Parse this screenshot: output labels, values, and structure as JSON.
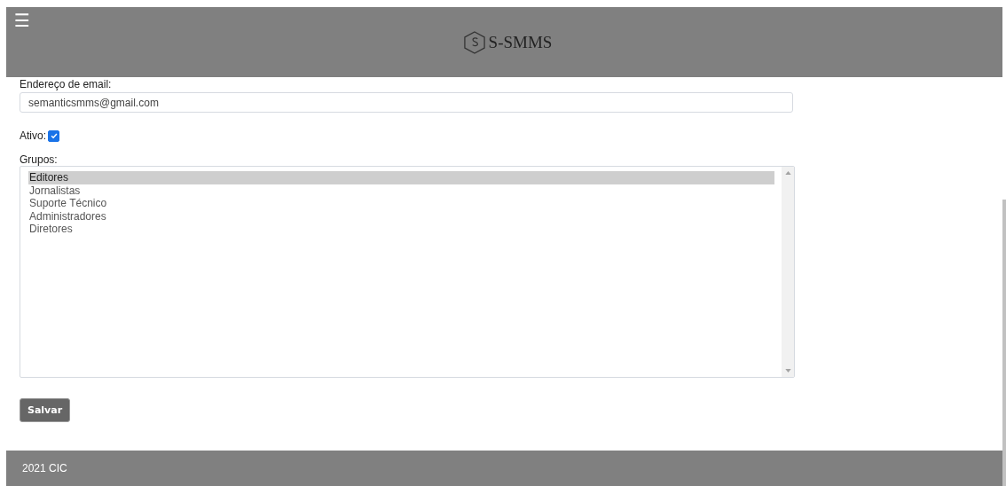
{
  "header": {
    "menu_icon": "☰",
    "brand": "S-SMMS"
  },
  "form": {
    "email": {
      "label": "Endereço de email:",
      "value": "semanticsmms@gmail.com"
    },
    "active": {
      "label": "Ativo:",
      "checked": true
    },
    "groups": {
      "label": "Grupos:",
      "options": [
        {
          "label": "Editores",
          "selected": true
        },
        {
          "label": "Jornalistas",
          "selected": false
        },
        {
          "label": "Suporte Técnico",
          "selected": false
        },
        {
          "label": "Administradores",
          "selected": false
        },
        {
          "label": "Diretores",
          "selected": false
        }
      ]
    },
    "submit": "Salvar"
  },
  "footer": {
    "text": "2021 CIC"
  }
}
